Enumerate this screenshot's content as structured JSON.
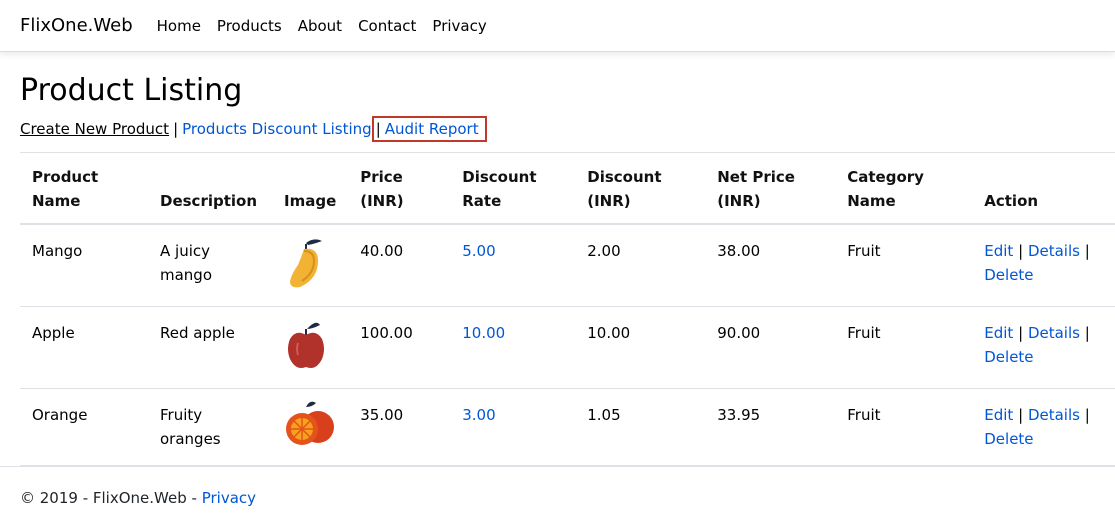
{
  "navbar": {
    "brand": "FlixOne.Web",
    "items": [
      "Home",
      "Products",
      "About",
      "Contact",
      "Privacy"
    ]
  },
  "page": {
    "title": "Product Listing",
    "create_link": "Create New Product",
    "discount_link": "Products Discount Listing",
    "audit_link": "Audit Report",
    "separator": "|"
  },
  "table": {
    "headers": [
      "Product Name",
      "Description",
      "Image",
      "Price (INR)",
      "Discount Rate",
      "Discount (INR)",
      "Net Price (INR)",
      "Category Name",
      "Action"
    ],
    "rows": [
      {
        "name": "Mango",
        "description": "A juicy mango",
        "image": "mango-icon",
        "price": "40.00",
        "discount_rate": "5.00",
        "discount": "2.00",
        "net_price": "38.00",
        "category": "Fruit"
      },
      {
        "name": "Apple",
        "description": "Red apple",
        "image": "apple-icon",
        "price": "100.00",
        "discount_rate": "10.00",
        "discount": "10.00",
        "net_price": "90.00",
        "category": "Fruit"
      },
      {
        "name": "Orange",
        "description": "Fruity oranges",
        "image": "orange-icon",
        "price": "35.00",
        "discount_rate": "3.00",
        "discount": "1.05",
        "net_price": "33.95",
        "category": "Fruit"
      }
    ],
    "actions": {
      "edit": "Edit",
      "details": "Details",
      "delete": "Delete",
      "separator": "|"
    }
  },
  "footer": {
    "text": "© 2019 - FlixOne.Web -",
    "privacy": "Privacy"
  },
  "colors": {
    "link": "#0056d6",
    "highlight_box": "#c0392b"
  }
}
